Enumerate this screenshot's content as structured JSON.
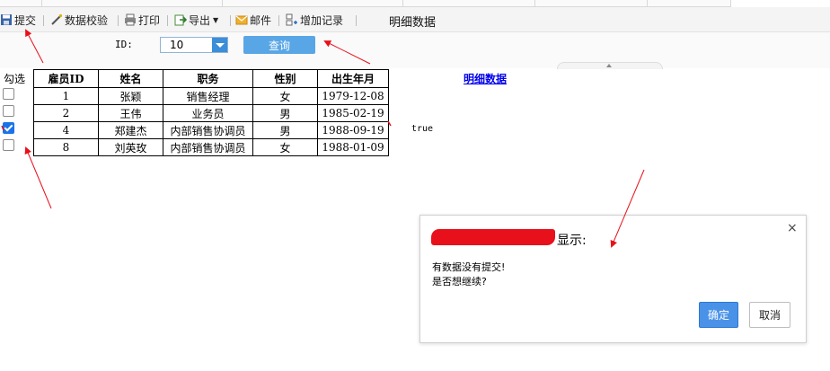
{
  "toolbar": {
    "submit": "提交",
    "validate": "数据校验",
    "print": "打印",
    "export": "导出",
    "mail": "邮件",
    "add_record": "增加记录",
    "title": "明细数据"
  },
  "params": {
    "id_label": "ID:",
    "id_value": "10",
    "query_button": "查询"
  },
  "grid": {
    "select_header": "勾选",
    "columns": [
      "雇员ID",
      "姓名",
      "职务",
      "性别",
      "出生年月"
    ],
    "rows": [
      {
        "id": "1",
        "name": "张颖",
        "title": "销售经理",
        "gender": "女",
        "birth": "1979-12-08",
        "checked": false
      },
      {
        "id": "2",
        "name": "王伟",
        "title": "业务员",
        "gender": "男",
        "birth": "1985-02-19",
        "checked": false
      },
      {
        "id": "4",
        "name": "郑建杰",
        "title": "内部销售协调员",
        "gender": "男",
        "birth": "1988-09-19",
        "checked": true
      },
      {
        "id": "8",
        "name": "刘英玫",
        "title": "内部销售协调员",
        "gender": "女",
        "birth": "1988-01-09",
        "checked": false
      }
    ],
    "detail_link": "明细数据",
    "side_value": "true"
  },
  "dialog": {
    "title_suffix": "显示:",
    "close_symbol": "×",
    "message_line1": "有数据没有提交!",
    "message_line2": "是否想继续?",
    "ok_label": "确定",
    "cancel_label": "取消"
  },
  "colors": {
    "accent": "#4a92e8",
    "query_button": "#59a6e6",
    "annotation_red": "#e8101a",
    "link": "#0000ee"
  }
}
